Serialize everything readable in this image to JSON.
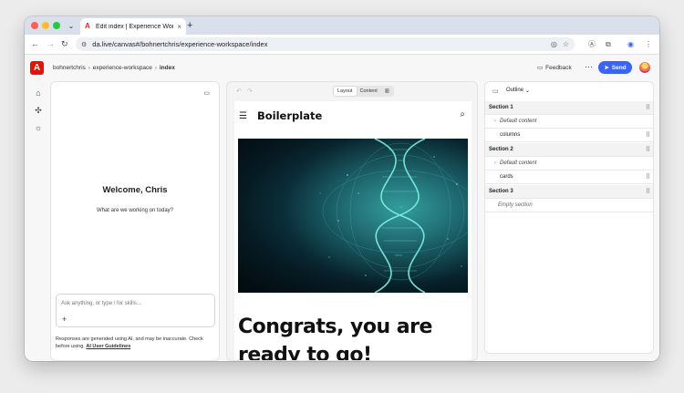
{
  "browser": {
    "tab_title": "Edit index | Experience Worksp",
    "url": "da.live/canvas#/bohnertchris/experience-workspace/index",
    "new_tab_label": "+"
  },
  "app": {
    "breadcrumb": [
      {
        "label": "bohnertchris"
      },
      {
        "label": "experience-workspace"
      },
      {
        "label": "index"
      }
    ],
    "feedback_label": "Feedback",
    "more_label": "···",
    "send_label": "Send"
  },
  "chat": {
    "welcome": "Welcome, Chris",
    "subtitle": "What are we working on today?",
    "prompt_placeholder": "Ask anything, or type / for skills...",
    "add_label": "+",
    "disclaimer_text": "Responses are generated using AI, and may be inaccurate. Check before using.",
    "disclaimer_link": "AI User Guidelines"
  },
  "document": {
    "view_tabs": [
      {
        "label": "Layout",
        "active": true
      },
      {
        "label": "Content",
        "active": false
      }
    ],
    "site_title": "Boilerplate",
    "headline": "Congrats, you are ready to go!"
  },
  "outline": {
    "label": "Outline",
    "rows": [
      {
        "label": "Section 1",
        "kind": "section"
      },
      {
        "label": "Default content",
        "kind": "default"
      },
      {
        "label": "columns",
        "kind": "block"
      },
      {
        "label": "Section 2",
        "kind": "section"
      },
      {
        "label": "Default content",
        "kind": "default"
      },
      {
        "label": "cards",
        "kind": "block"
      },
      {
        "label": "Section 3",
        "kind": "section"
      },
      {
        "label": "Empty section",
        "kind": "empty"
      }
    ]
  },
  "icons": {
    "rail": [
      "home-icon",
      "blocks-icon",
      "lightbulb-icon"
    ]
  },
  "colors": {
    "accent": "#3b63fb",
    "adobe_red": "#eb1000"
  }
}
